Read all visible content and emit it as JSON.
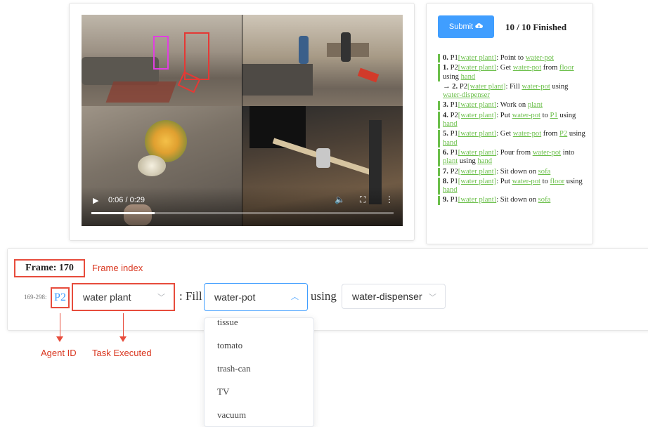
{
  "video": {
    "time": "0:06 / 0:29",
    "progress": 0.21,
    "controls": {
      "play_icon": "play-icon",
      "volume_icon": "volume-icon",
      "fullscreen_icon": "fullscreen-icon",
      "more_icon": "more-icon"
    }
  },
  "task_panel": {
    "submit_label": "Submit",
    "submit_icon": "cloud-upload-icon",
    "finished": "10 / 10 Finished",
    "accent_color": "#6bbf4a",
    "tasks": [
      {
        "index": "0.",
        "agent": "P1",
        "task": "water plant",
        "parts": [
          ": Point to ",
          "water-pot"
        ]
      },
      {
        "index": "1.",
        "agent": "P2",
        "task": "water plant",
        "parts": [
          ": Get ",
          "water-pot",
          " from ",
          "floor",
          " using ",
          "hand"
        ]
      },
      {
        "index": "→ 2.",
        "agent": "P2",
        "task": "water plant",
        "parts": [
          ": Fill ",
          "water-pot",
          " using ",
          "water-dispenser"
        ]
      },
      {
        "index": "3.",
        "agent": "P1",
        "task": "water plant",
        "parts": [
          ": Work on ",
          "plant"
        ]
      },
      {
        "index": "4.",
        "agent": "P2",
        "task": "water plant",
        "parts": [
          ": Put ",
          "water-pot",
          " to ",
          "P1",
          " using ",
          "hand"
        ]
      },
      {
        "index": "5.",
        "agent": "P1",
        "task": "water plant",
        "parts": [
          ": Get ",
          "water-pot",
          " from ",
          "P2",
          " using ",
          "hand"
        ]
      },
      {
        "index": "6.",
        "agent": "P1",
        "task": "water plant",
        "parts": [
          ": Pour from ",
          "water-pot",
          " into ",
          "plant",
          " using ",
          "hand"
        ]
      },
      {
        "index": "7.",
        "agent": "P2",
        "task": "water plant",
        "parts": [
          ": Sit down on ",
          "sofa"
        ]
      },
      {
        "index": "8.",
        "agent": "P1",
        "task": "water plant",
        "parts": [
          ": Put ",
          "water-pot",
          " to ",
          "floor",
          " using ",
          "hand"
        ]
      },
      {
        "index": "9.",
        "agent": "P1",
        "task": "water plant",
        "parts": [
          ": Sit down on ",
          "sofa"
        ]
      }
    ]
  },
  "frame": {
    "title": "Frame: 170",
    "range": "169-298:",
    "agent_id": "P2",
    "task_select": "water plant",
    "action_word": ": Fill",
    "object_select": "water-pot",
    "using_word": "using",
    "tool_select": "water-dispenser",
    "dropdown_options": [
      "tissue",
      "tomato",
      "trash-can",
      "TV",
      "vacuum"
    ]
  },
  "annotations": {
    "frame_index": "Frame index",
    "agent_id": "Agent ID",
    "task_executed": "Task Executed",
    "color": "#e74c3c"
  }
}
